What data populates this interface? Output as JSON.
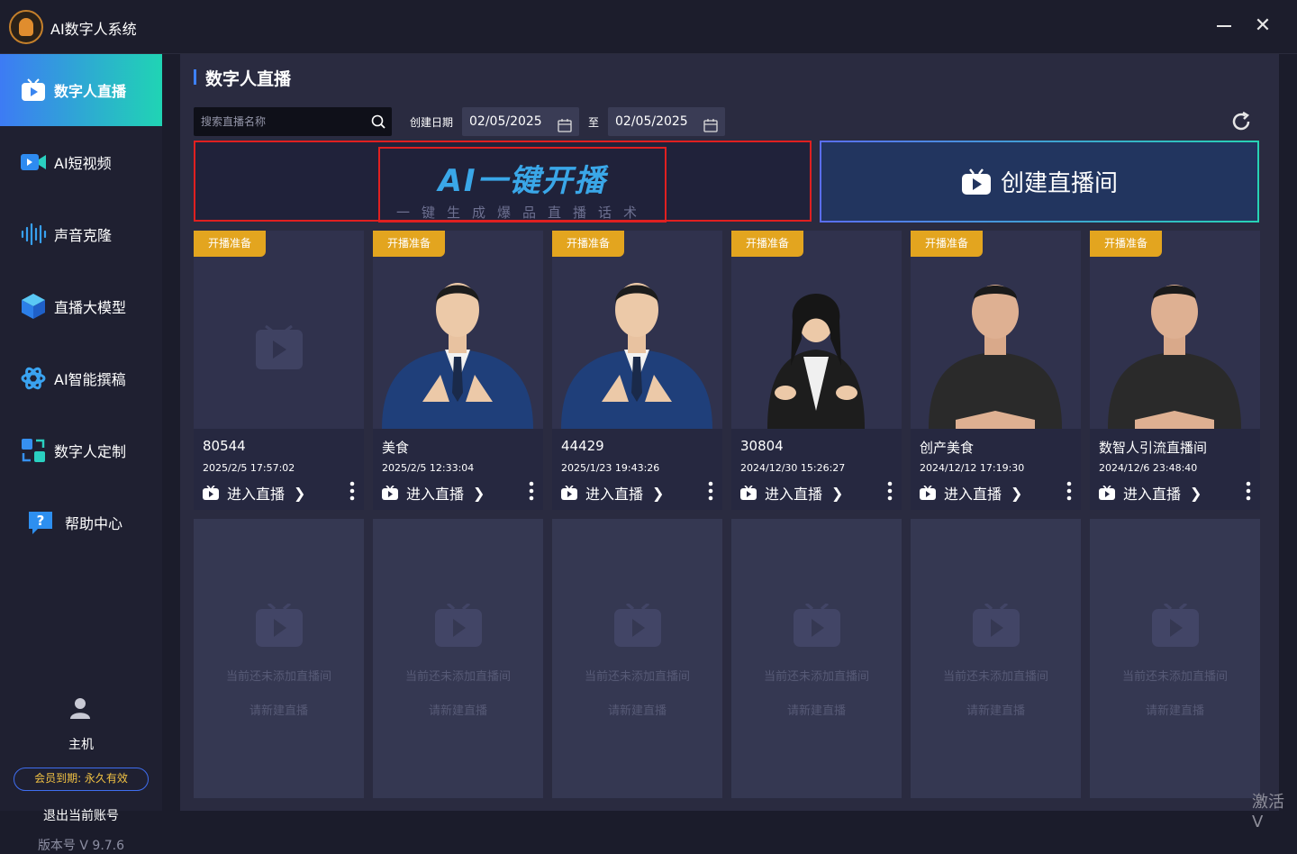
{
  "app": {
    "title": "AI数字人系统"
  },
  "sidebar": {
    "items": [
      {
        "label": "数字人直播",
        "icon": "live-tv-icon",
        "active": true
      },
      {
        "label": "AI短视频",
        "icon": "video-camera-icon",
        "active": false
      },
      {
        "label": "声音克隆",
        "icon": "sound-wave-icon",
        "active": false
      },
      {
        "label": "直播大模型",
        "icon": "cube-icon",
        "active": false
      },
      {
        "label": "AI智能撰稿",
        "icon": "openai-knot-icon",
        "active": false
      },
      {
        "label": "数字人定制",
        "icon": "custom-swap-icon",
        "active": false
      },
      {
        "label": "帮助中心",
        "icon": "help-chat-icon",
        "active": false
      }
    ],
    "user": {
      "name": "主机",
      "icon": "user-icon"
    },
    "membership": "会员到期: 永久有效",
    "logout": "退出当前账号",
    "version": "版本号 V 9.7.6"
  },
  "main": {
    "title": "数字人直播",
    "search_placeholder": "搜索直播名称",
    "date_label": "创建日期",
    "date_from": "02/05/2025",
    "date_to_label": "至",
    "date_to": "02/05/2025"
  },
  "banners": {
    "ai_title": "AI一键开播",
    "ai_subtitle": "一键生成爆品直播话术",
    "create": "创建直播间"
  },
  "rooms": [
    {
      "tag": "开播准备",
      "name": "80544",
      "date": "2025/2/5 17:57:02",
      "enter": "进入直播",
      "thumb": "placeholder"
    },
    {
      "tag": "开播准备",
      "name": "美食",
      "date": "2025/2/5 12:33:04",
      "enter": "进入直播",
      "thumb": "man-suit"
    },
    {
      "tag": "开播准备",
      "name": "44429",
      "date": "2025/1/23 19:43:26",
      "enter": "进入直播",
      "thumb": "man-suit"
    },
    {
      "tag": "开播准备",
      "name": "30804",
      "date": "2024/12/30 15:26:27",
      "enter": "进入直播",
      "thumb": "woman"
    },
    {
      "tag": "开播准备",
      "name": "创产美食",
      "date": "2024/12/12 17:19:30",
      "enter": "进入直播",
      "thumb": "man-tshirt"
    },
    {
      "tag": "开播准备",
      "name": "数智人引流直播间",
      "date": "2024/12/6 23:48:40",
      "enter": "进入直播",
      "thumb": "man-tshirt"
    }
  ],
  "empty_slot": {
    "line1": "当前还未添加直播间",
    "line2": "请新建直播"
  },
  "watermark": "激活 V"
}
